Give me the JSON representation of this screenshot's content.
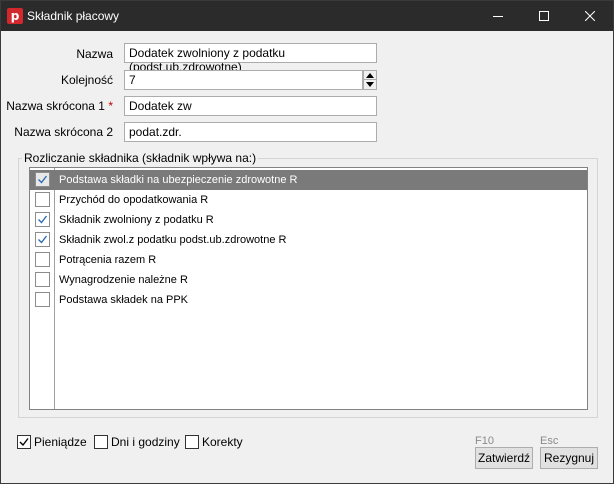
{
  "window": {
    "title": "Składnik płacowy",
    "app_icon_glyph": "p",
    "accent": "#d3272e"
  },
  "form": {
    "nazwa_label": "Nazwa",
    "nazwa_value": "Dodatek zwolniony z podatku (podst.ub.zdrowotne)",
    "kolejnosc_label": "Kolejność",
    "kolejnosc_value": "7",
    "skrocona1_label": "Nazwa skrócona 1",
    "skrocona1_required": "*",
    "skrocona1_value": "Dodatek zw",
    "skrocona2_label": "Nazwa skrócona 2",
    "skrocona2_value": "podat.zdr."
  },
  "group": {
    "title": "Rozliczanie składnika (składnik wpływa na:)",
    "items": [
      {
        "label": "Podstawa składki na ubezpieczenie zdrowotne R",
        "checked": true,
        "selected": true
      },
      {
        "label": "Przychód do opodatkowania R",
        "checked": false,
        "selected": false
      },
      {
        "label": "Składnik zwolniony z podatku R",
        "checked": true,
        "selected": false
      },
      {
        "label": "Składnik zwol.z podatku podst.ub.zdrowotne R",
        "checked": true,
        "selected": false
      },
      {
        "label": "Potrącenia razem R",
        "checked": false,
        "selected": false
      },
      {
        "label": "Wynagrodzenie należne R",
        "checked": false,
        "selected": false
      },
      {
        "label": "Podstawa składek na PPK",
        "checked": false,
        "selected": false
      }
    ]
  },
  "footer": {
    "pieniadze_label": "Pieniądze",
    "pieniadze_checked": true,
    "dni_label": "Dni i godziny",
    "dni_checked": false,
    "korekty_label": "Korekty",
    "korekty_checked": false,
    "confirm_hint": "F10",
    "confirm_label": "Zatwierdź",
    "cancel_hint": "Esc",
    "cancel_label": "Rezygnuj"
  },
  "icons": {
    "titlebar": [
      "minimize-icon",
      "maximize-icon",
      "close-icon"
    ],
    "check": "checkmark-icon",
    "spinner": [
      "spin-up-icon",
      "spin-down-icon"
    ]
  }
}
